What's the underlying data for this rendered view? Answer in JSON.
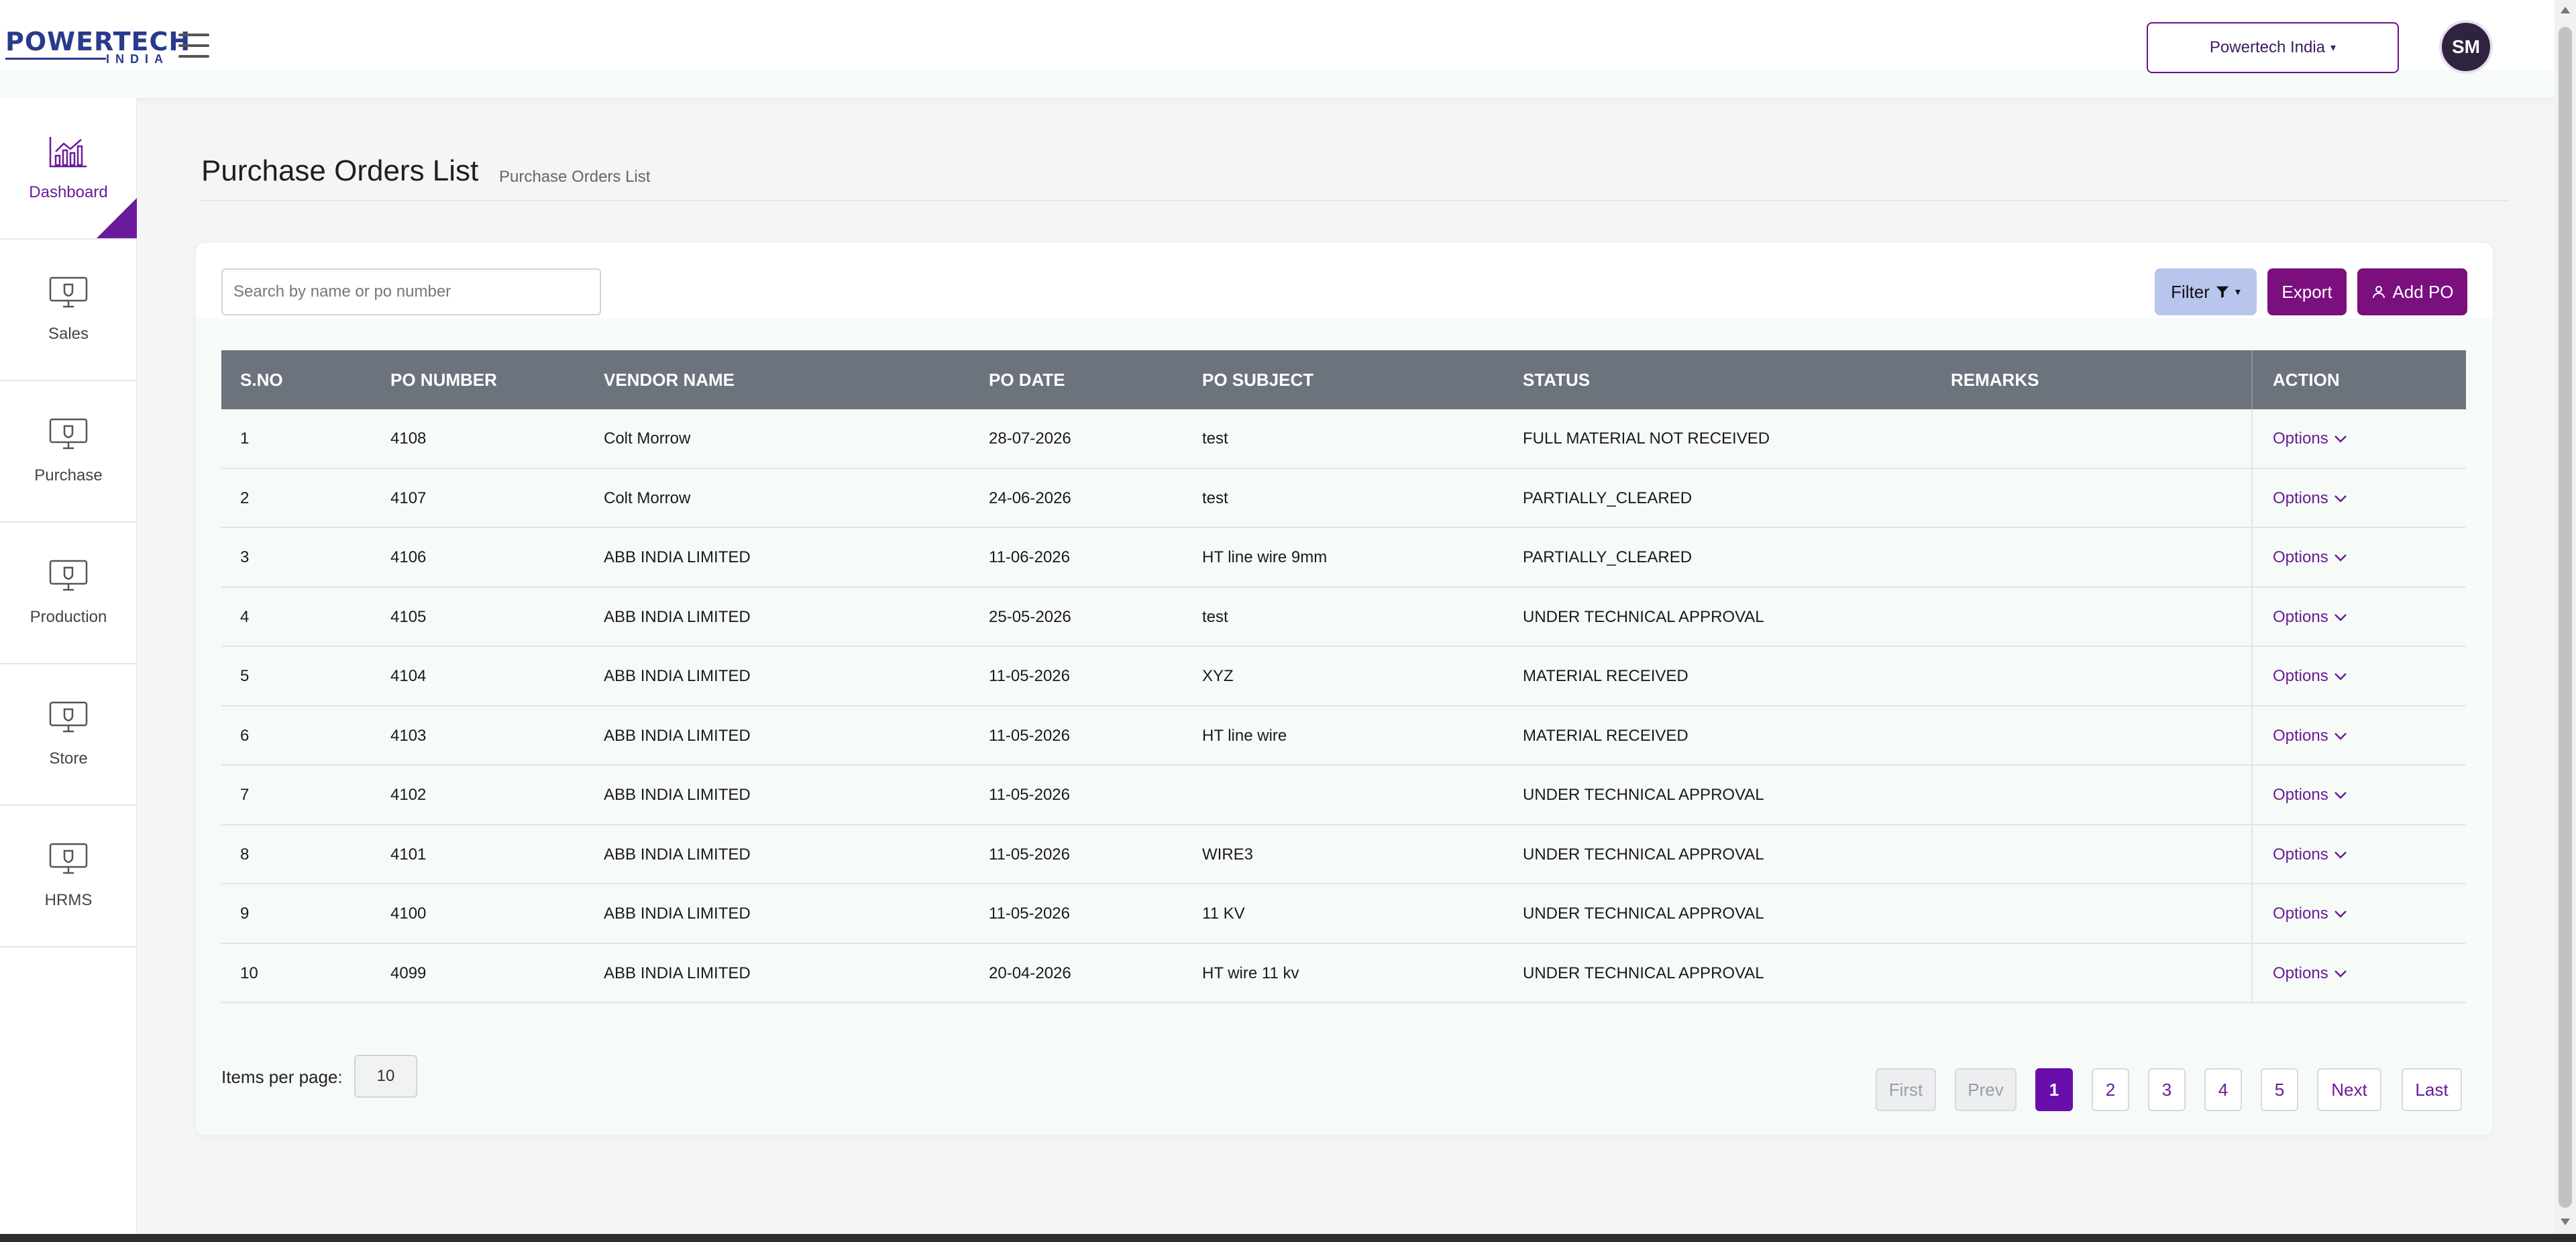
{
  "header": {
    "logo_main": "POWERTECH",
    "logo_sub": "INDIA",
    "org_selector": "Powertech India",
    "avatar_initials": "SM"
  },
  "sidebar": {
    "items": [
      {
        "label": "Dashboard",
        "icon": "chart-icon",
        "active": true
      },
      {
        "label": "Sales",
        "icon": "monitor-icon"
      },
      {
        "label": "Purchase",
        "icon": "monitor-icon"
      },
      {
        "label": "Production",
        "icon": "monitor-icon"
      },
      {
        "label": "Store",
        "icon": "monitor-icon"
      },
      {
        "label": "HRMS",
        "icon": "monitor-icon"
      }
    ]
  },
  "page": {
    "title": "Purchase Orders List",
    "breadcrumb": "Purchase Orders List"
  },
  "toolbar": {
    "search_placeholder": "Search by name or po number",
    "filter_label": "Filter",
    "export_label": "Export",
    "add_label": "Add PO"
  },
  "table": {
    "columns": [
      "S.NO",
      "PO NUMBER",
      "VENDOR NAME",
      "PO DATE",
      "PO SUBJECT",
      "STATUS",
      "REMARKS",
      "ACTION"
    ],
    "option_label": "Options",
    "rows": [
      {
        "sno": "1",
        "po": "4108",
        "vendor": "Colt Morrow",
        "date": "28-07-2026",
        "subject": "test",
        "status": "FULL MATERIAL NOT RECEIVED",
        "remarks": ""
      },
      {
        "sno": "2",
        "po": "4107",
        "vendor": "Colt Morrow",
        "date": "24-06-2026",
        "subject": "test",
        "status": "PARTIALLY_CLEARED",
        "remarks": ""
      },
      {
        "sno": "3",
        "po": "4106",
        "vendor": "ABB INDIA LIMITED",
        "date": "11-06-2026",
        "subject": "HT line wire 9mm",
        "status": "PARTIALLY_CLEARED",
        "remarks": ""
      },
      {
        "sno": "4",
        "po": "4105",
        "vendor": "ABB INDIA LIMITED",
        "date": "25-05-2026",
        "subject": "test",
        "status": "UNDER TECHNICAL APPROVAL",
        "remarks": ""
      },
      {
        "sno": "5",
        "po": "4104",
        "vendor": "ABB INDIA LIMITED",
        "date": "11-05-2026",
        "subject": "XYZ",
        "status": "MATERIAL RECEIVED",
        "remarks": ""
      },
      {
        "sno": "6",
        "po": "4103",
        "vendor": "ABB INDIA LIMITED",
        "date": "11-05-2026",
        "subject": "HT line wire",
        "status": "MATERIAL RECEIVED",
        "remarks": ""
      },
      {
        "sno": "7",
        "po": "4102",
        "vendor": "ABB INDIA LIMITED",
        "date": "11-05-2026",
        "subject": "",
        "status": "UNDER TECHNICAL APPROVAL",
        "remarks": ""
      },
      {
        "sno": "8",
        "po": "4101",
        "vendor": "ABB INDIA LIMITED",
        "date": "11-05-2026",
        "subject": "WIRE3",
        "status": "UNDER TECHNICAL APPROVAL",
        "remarks": ""
      },
      {
        "sno": "9",
        "po": "4100",
        "vendor": "ABB INDIA LIMITED",
        "date": "11-05-2026",
        "subject": "11 KV",
        "status": "UNDER TECHNICAL APPROVAL",
        "remarks": ""
      },
      {
        "sno": "10",
        "po": "4099",
        "vendor": "ABB INDIA LIMITED",
        "date": "20-04-2026",
        "subject": "HT wire 11 kv",
        "status": "UNDER TECHNICAL APPROVAL",
        "remarks": ""
      }
    ]
  },
  "footer": {
    "items_per_page_label": "Items per page:",
    "items_per_page_value": "10",
    "pagination": {
      "first": "First",
      "prev": "Prev",
      "pages": [
        "1",
        "2",
        "3",
        "4",
        "5"
      ],
      "current": "1",
      "next": "Next",
      "last": "Last"
    }
  },
  "colors": {
    "accent": "#7b0f7e",
    "active_page": "#6a0dad",
    "table_header": "#6c737d",
    "filter_button": "#b8c6ee"
  }
}
